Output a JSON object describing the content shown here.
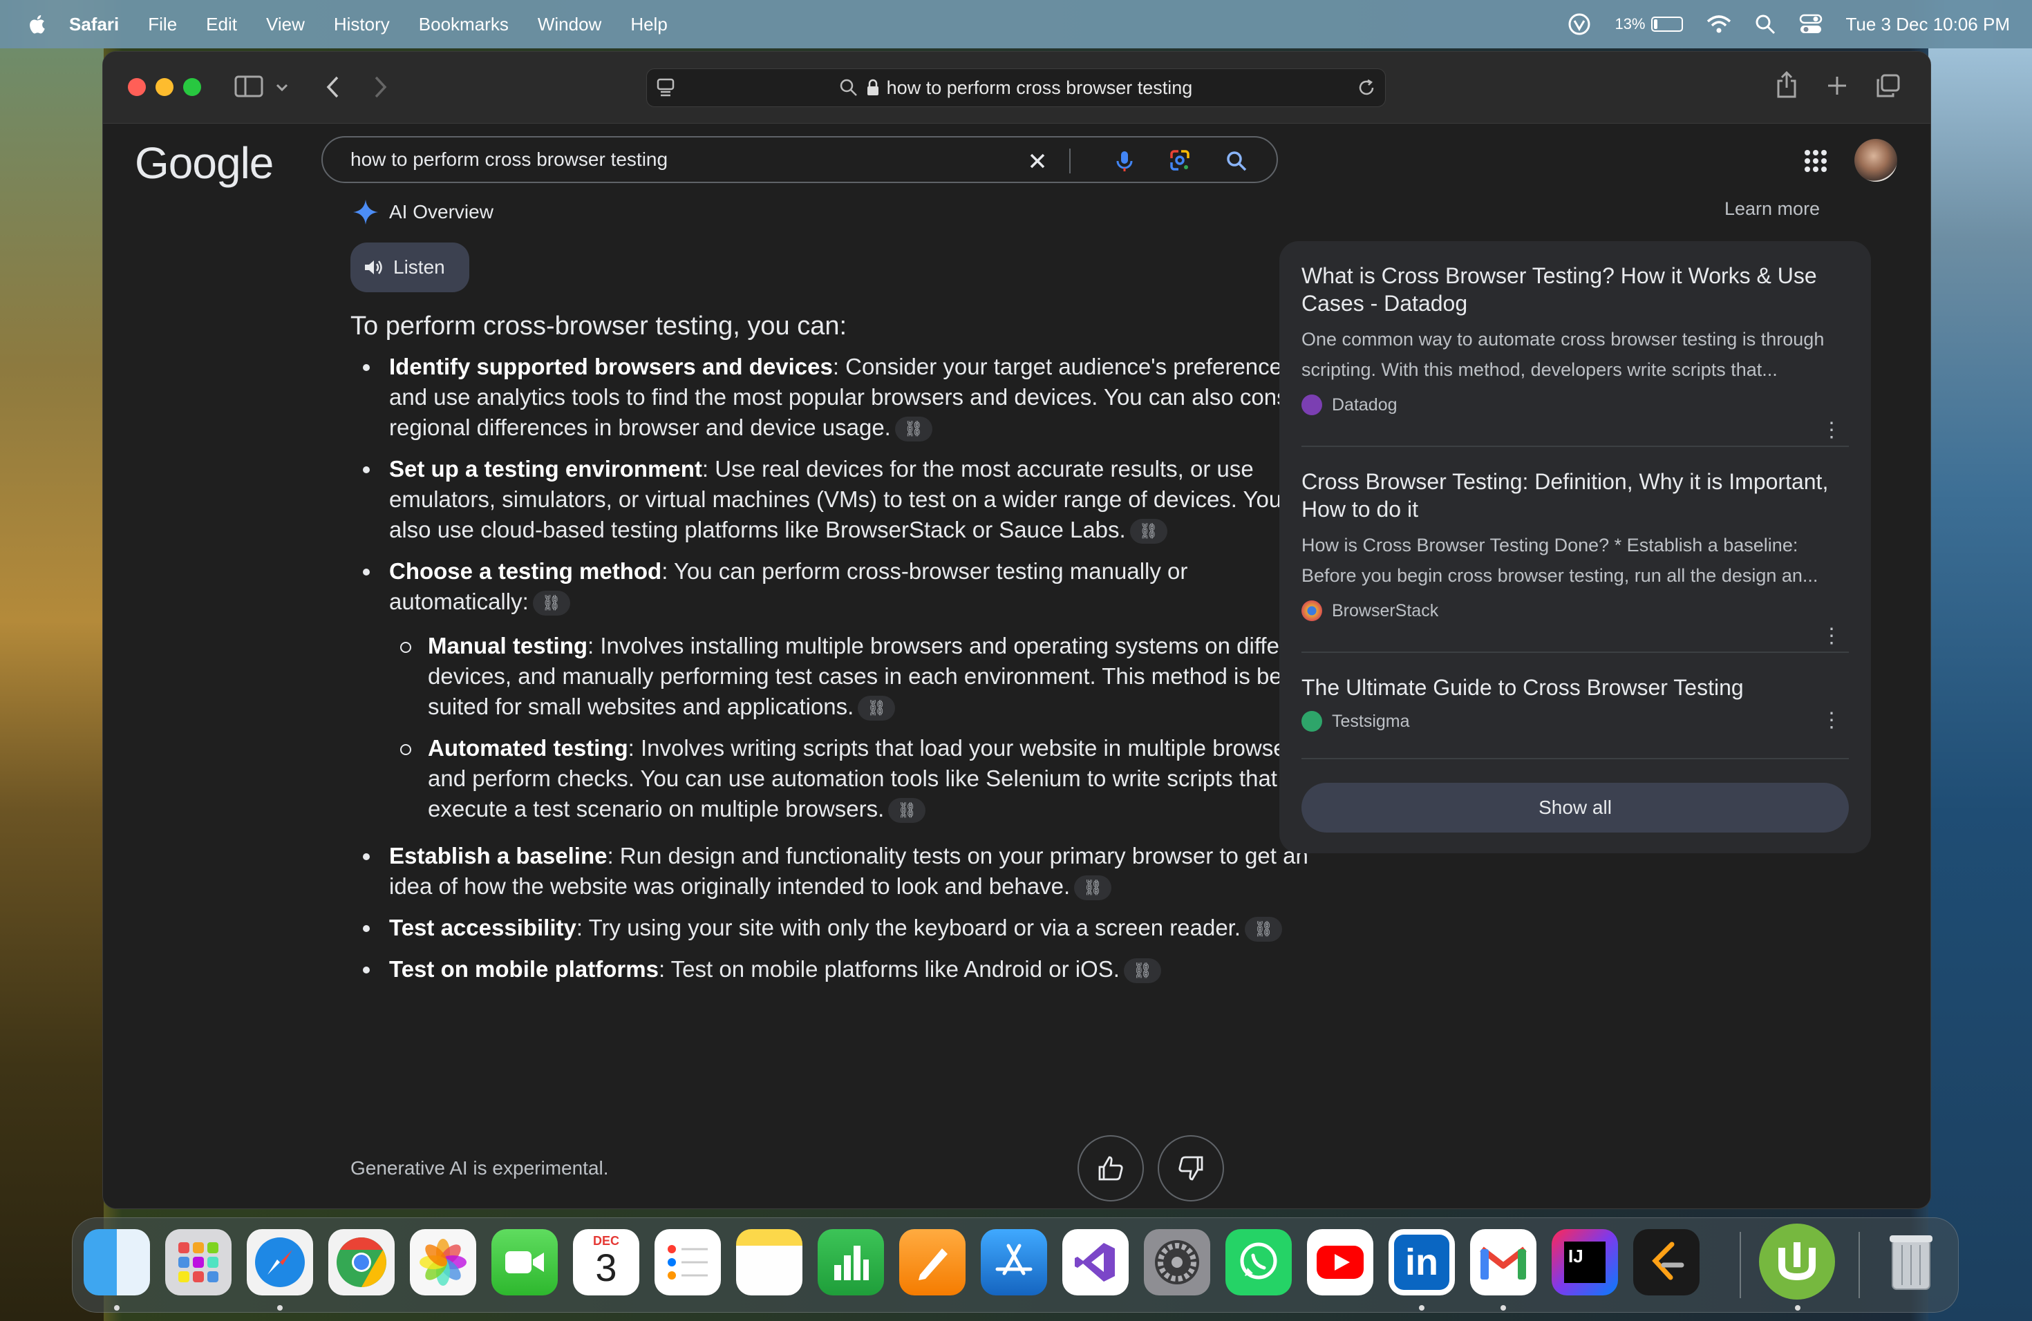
{
  "menubar": {
    "items": [
      "Safari",
      "File",
      "Edit",
      "View",
      "History",
      "Bookmarks",
      "Window",
      "Help"
    ],
    "battery": "13%",
    "battery_level": 0.13,
    "datetime": "Tue 3 Dec  10:06 PM"
  },
  "browser": {
    "url": "how to perform cross browser testing"
  },
  "google": {
    "logo": "Google",
    "query": "how to perform cross browser testing"
  },
  "ai": {
    "heading": "AI Overview",
    "learn_more": "Learn more",
    "listen": "Listen",
    "intro": "To perform cross-browser testing, you can:",
    "bullets": [
      {
        "title": "Identify supported browsers and devices",
        "text": ": Consider your target audience's preferences and use analytics tools to find the most popular browsers and devices. You can also consider regional differences in browser and device usage."
      },
      {
        "title": "Set up a testing environment",
        "text": ": Use real devices for the most accurate results, or use emulators, simulators, or virtual machines (VMs) to test on a wider range of devices. You can also use cloud-based testing platforms like BrowserStack or Sauce Labs."
      },
      {
        "title": "Choose a testing method",
        "text": ": You can perform cross-browser testing manually or automatically:"
      }
    ],
    "sub_bullets": [
      {
        "title": "Manual testing",
        "text": ": Involves installing multiple browsers and operating systems on different devices, and manually performing test cases in each environment. This method is best suited for small websites and applications."
      },
      {
        "title": "Automated testing",
        "text": ": Involves writing scripts that load your website in multiple browsers and perform checks. You can use automation tools like Selenium to write scripts that can execute a test scenario on multiple browsers."
      }
    ],
    "bullets2": [
      {
        "title": "Establish a baseline",
        "text": ": Run design and functionality tests on your primary browser to get an idea of how the website was originally intended to look and behave."
      },
      {
        "title": "Test accessibility",
        "text": ": Try using your site with only the keyboard or via a screen reader."
      },
      {
        "title": "Test on mobile platforms",
        "text": ": Test on mobile platforms like Android or iOS."
      }
    ],
    "disclaimer": "Generative AI is experimental."
  },
  "sources": [
    {
      "title": "What is Cross Browser Testing? How it Works & Use Cases - Datadog",
      "snippet": "One common way to automate cross browser testing is through scripting. With this method, developers write scripts that...",
      "site": "Datadog",
      "fav_color": "#7b3fb2"
    },
    {
      "title": "Cross Browser Testing: Definition, Why it is Important, How to do it",
      "snippet": "How is Cross Browser Testing Done? * Establish a baseline: Before you begin cross browser testing, run all the design an...",
      "site": "BrowserStack",
      "fav_color": "#e8a23a"
    },
    {
      "title": "The Ultimate Guide to Cross Browser Testing",
      "snippet": "",
      "site": "Testsigma",
      "fav_color": "#2ea56a"
    }
  ],
  "show_all": "Show all",
  "dock": {
    "calendar_month": "DEC",
    "calendar_day": "3",
    "apps": [
      "finder-icon",
      "launchpad-icon",
      "safari-icon",
      "chrome-icon",
      "photos-icon",
      "facetime-icon",
      "calendar-icon",
      "reminders-icon",
      "notes-icon",
      "numbers-icon",
      "pages-icon",
      "app-store-icon",
      "visual-studio-icon",
      "system-settings-icon",
      "whatsapp-icon",
      "youtube-icon",
      "linkedin-icon",
      "gmail-icon",
      "intellij-icon",
      "leetcode-icon",
      "utorrent-icon",
      "trash-icon"
    ]
  }
}
